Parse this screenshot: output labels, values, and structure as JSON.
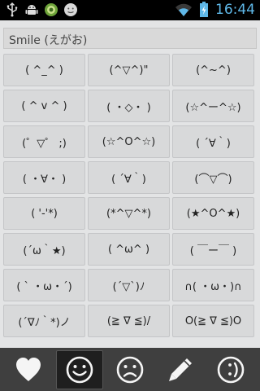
{
  "status_bar": {
    "time": "16:44",
    "icons": [
      "usb-icon",
      "android-debug-icon",
      "app-notification-icon",
      "face-notification-icon",
      "wifi-icon",
      "battery-icon"
    ]
  },
  "header": {
    "title": "Smile (えがお)"
  },
  "emoticons": [
    "( ^_^ )",
    "(^▽^)\"",
    "(^~^)",
    "( ^ v ^ )",
    "( ・◇・ )",
    "(☆^ー^☆)",
    "(゜▽゜ ;)",
    "(☆^O^☆)",
    "(  ´∀｀)",
    "( ・∀・ )",
    "(  ´∀｀)",
    "(⌒▽⌒)",
    "( '-'*)",
    "(*^▽^*)",
    "(★^O^★)",
    "(´ω｀★)",
    "( ^ω^ )",
    "( ￣ー￣ )",
    "( ` ・ω・´)",
    "(´▽`)ﾉ",
    "∩( ・ω・)∩",
    "(´∇ﾉ｀*)ノ",
    "(≧ ∇ ≦)/",
    "O(≧ ∇ ≦)O"
  ],
  "tabs": [
    {
      "name": "tab-love",
      "icon": "heart-icon",
      "active": false
    },
    {
      "name": "tab-smile",
      "icon": "smile-face-icon",
      "active": true
    },
    {
      "name": "tab-sad",
      "icon": "sad-face-icon",
      "active": false
    },
    {
      "name": "tab-edit",
      "icon": "pencil-icon",
      "active": false
    },
    {
      "name": "tab-other",
      "icon": "wink-face-icon",
      "active": false
    }
  ],
  "colors": {
    "accent": "#5fb8e8",
    "background": "#e3e4e5",
    "tabbar": "#3f3f3f"
  }
}
